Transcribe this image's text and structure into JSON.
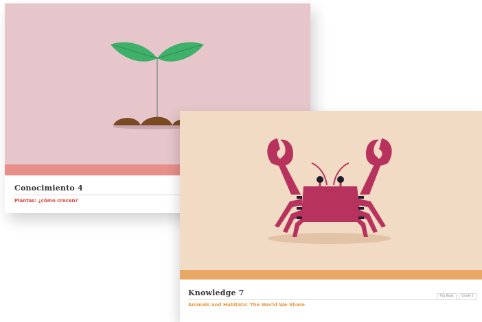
{
  "cards": [
    {
      "title": "Conocimiento 4",
      "subtitle": "Plantas: ¿cómo crecen?",
      "icon": "seedling-icon",
      "colors": {
        "background": "#e6c6ca",
        "stripe": "#e88f8a",
        "subtitle": "#e0423b",
        "leaf": "#3fb06a",
        "soil": "#7a4a22"
      }
    },
    {
      "title": "Knowledge 7",
      "subtitle": "Animals and Habitats: The World We Share",
      "tags": [
        "Flip Book",
        "Grade 1"
      ],
      "icon": "crab-icon",
      "colors": {
        "background": "#f1dbc5",
        "stripe": "#e9a866",
        "subtitle": "#e9973d",
        "crab": "#b8325e"
      }
    }
  ]
}
